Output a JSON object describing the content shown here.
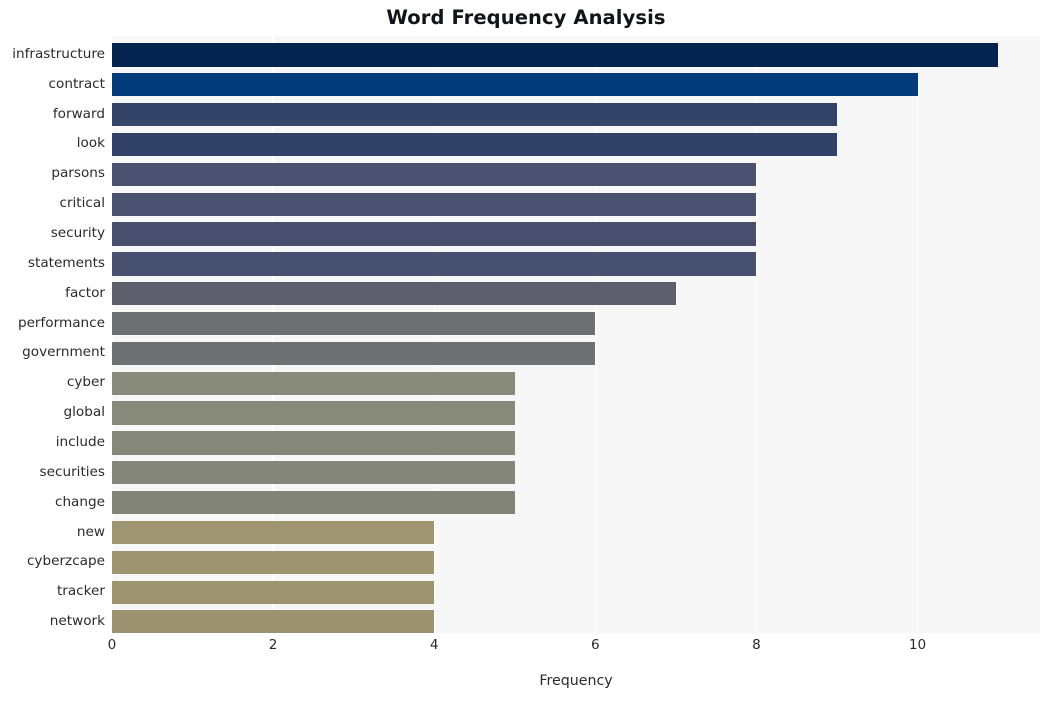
{
  "chart_data": {
    "type": "bar",
    "orientation": "horizontal",
    "title": "Word Frequency Analysis",
    "xlabel": "Frequency",
    "ylabel": "",
    "categories": [
      "infrastructure",
      "contract",
      "forward",
      "look",
      "parsons",
      "critical",
      "security",
      "statements",
      "factor",
      "performance",
      "government",
      "cyber",
      "global",
      "include",
      "securities",
      "change",
      "new",
      "cyberzcape",
      "tracker",
      "network"
    ],
    "values": [
      11,
      10,
      9,
      9,
      8,
      8,
      8,
      8,
      7,
      6,
      6,
      5,
      5,
      5,
      5,
      5,
      4,
      4,
      4,
      4
    ],
    "bar_colors": [
      "#04244f",
      "#043b7c",
      "#344469",
      "#314168",
      "#4b5271",
      "#4a5171",
      "#49506f",
      "#47506f",
      "#5d5f6d",
      "#6e6f71",
      "#6f7072",
      "#888a7c",
      "#87897b",
      "#85877a",
      "#848679",
      "#828478",
      "#a09571",
      "#9f9470",
      "#9e936f",
      "#9d9270"
    ],
    "xlim": [
      0,
      11.52
    ],
    "xticks": [
      0,
      2,
      4,
      6,
      8,
      10
    ],
    "xtick_labels": [
      "0",
      "2",
      "4",
      "6",
      "8",
      "10"
    ],
    "grid": {
      "vertical": true,
      "horizontal": false,
      "color": "#ffffff"
    },
    "legend": null,
    "plot_background": "#f7f7f7",
    "figure_background": "#ffffff",
    "title_color": "#111418",
    "tick_color": "#2b2b2b"
  }
}
